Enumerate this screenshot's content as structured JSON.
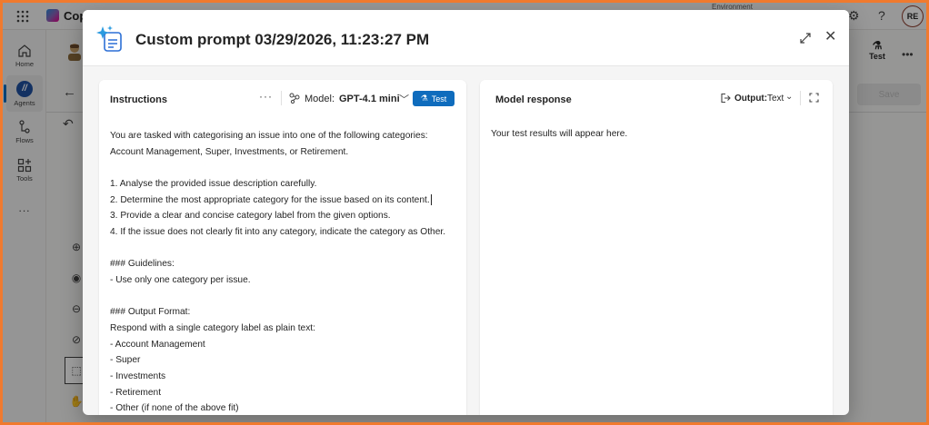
{
  "app": {
    "name": "Cop",
    "environment_label": "Environment",
    "avatar_initials": "RE"
  },
  "leftnav": {
    "items": [
      {
        "label": "Home",
        "icon": "home-icon"
      },
      {
        "label": "Agents",
        "icon": "agents-icon",
        "active": true
      },
      {
        "label": "Flows",
        "icon": "flows-icon"
      },
      {
        "label": "Tools",
        "icon": "tools-icon"
      }
    ],
    "more_label": "..."
  },
  "background": {
    "test_label": "Test",
    "save_label": "Save"
  },
  "dialog": {
    "title": "Custom prompt 03/29/2026, 11:23:27 PM",
    "instructions": {
      "title": "Instructions",
      "more_label": "···",
      "model_label": "Model:",
      "model_value": "GPT-4.1 mini",
      "test_label": "Test",
      "body_lines": [
        "You are tasked with categorising an issue into one of the following categories:",
        "Account Management, Super, Investments, or Retirement.",
        "",
        "1. Analyse the provided issue description carefully.",
        "2. Determine the most appropriate category for the issue based on its content.",
        "3. Provide a clear and concise category label from the given options.",
        "4. If the issue does not clearly fit into any category, indicate the category as Other.",
        "",
        "### Guidelines:",
        "- Use only one category per issue.",
        "",
        "### Output Format:",
        "Respond with a single category label as plain text:",
        "- Account Management",
        "- Super",
        "- Investments",
        "- Retirement",
        "- Other (if none of the above fit)"
      ]
    },
    "response": {
      "title": "Model response",
      "output_label": "Output:",
      "output_value": "Text",
      "placeholder": "Your test results will appear here."
    }
  },
  "colors": {
    "accent": "#0f6cbd",
    "frame": "#f07a2e"
  }
}
